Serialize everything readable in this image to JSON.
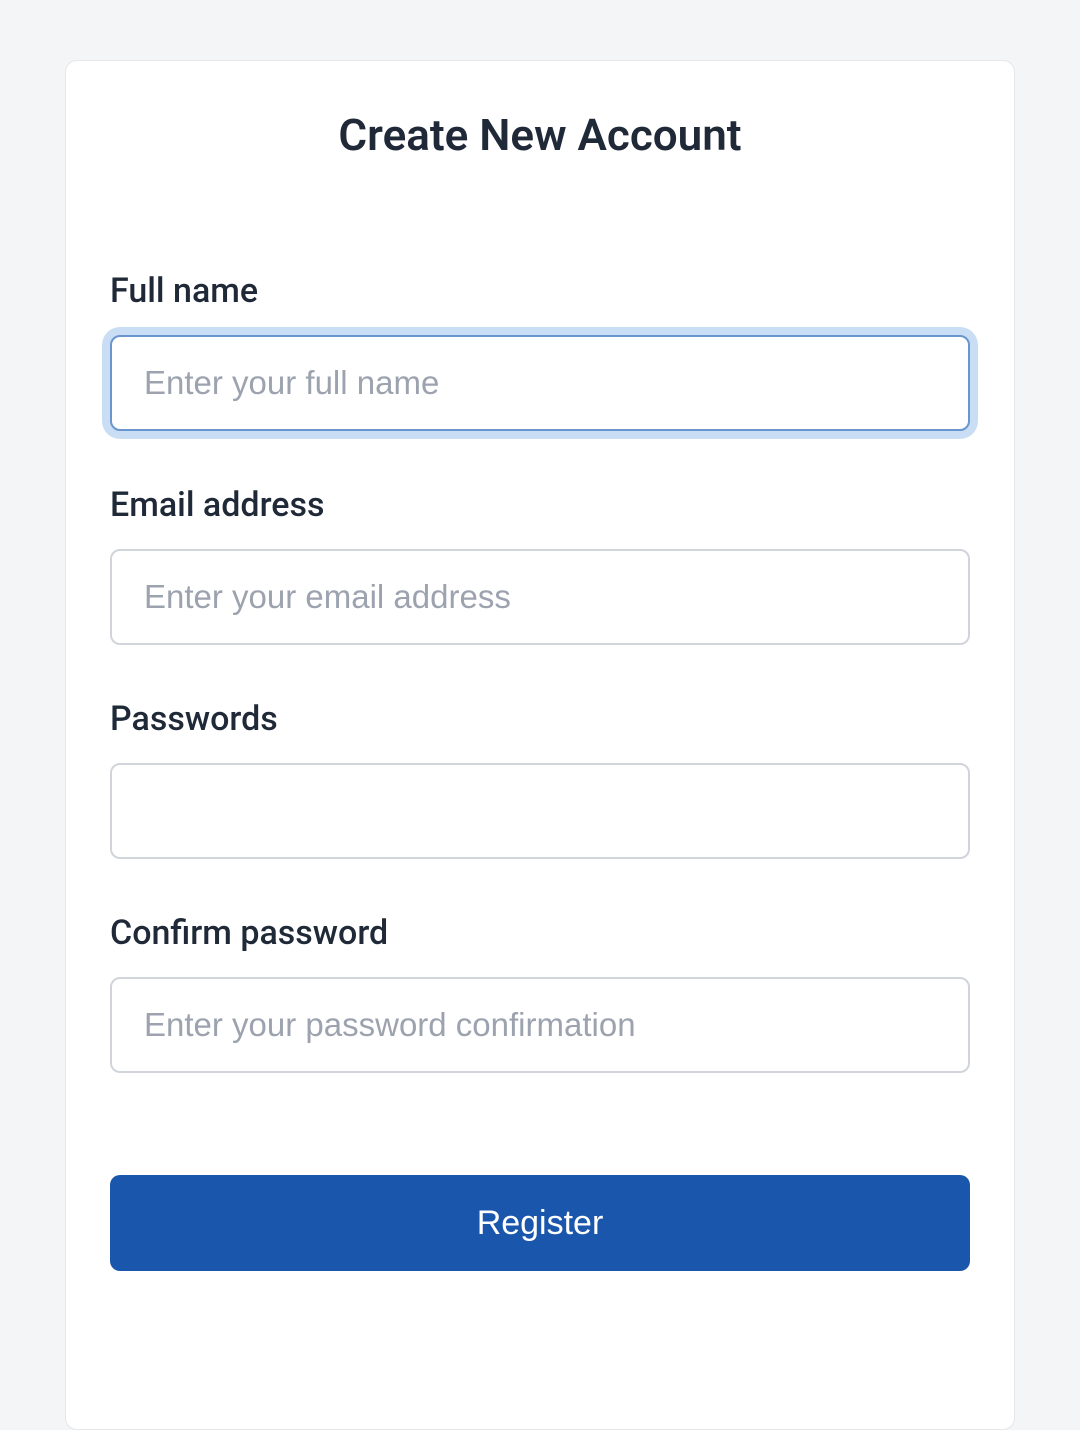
{
  "title": "Create New Account",
  "fields": {
    "full_name": {
      "label": "Full name",
      "placeholder": "Enter your full name",
      "value": ""
    },
    "email": {
      "label": "Email address",
      "placeholder": "Enter your email address",
      "value": ""
    },
    "password": {
      "label": "Passwords",
      "placeholder": "",
      "value": ""
    },
    "confirm_password": {
      "label": "Confirm password",
      "placeholder": "Enter your password confirmation",
      "value": ""
    }
  },
  "submit_label": "Register"
}
